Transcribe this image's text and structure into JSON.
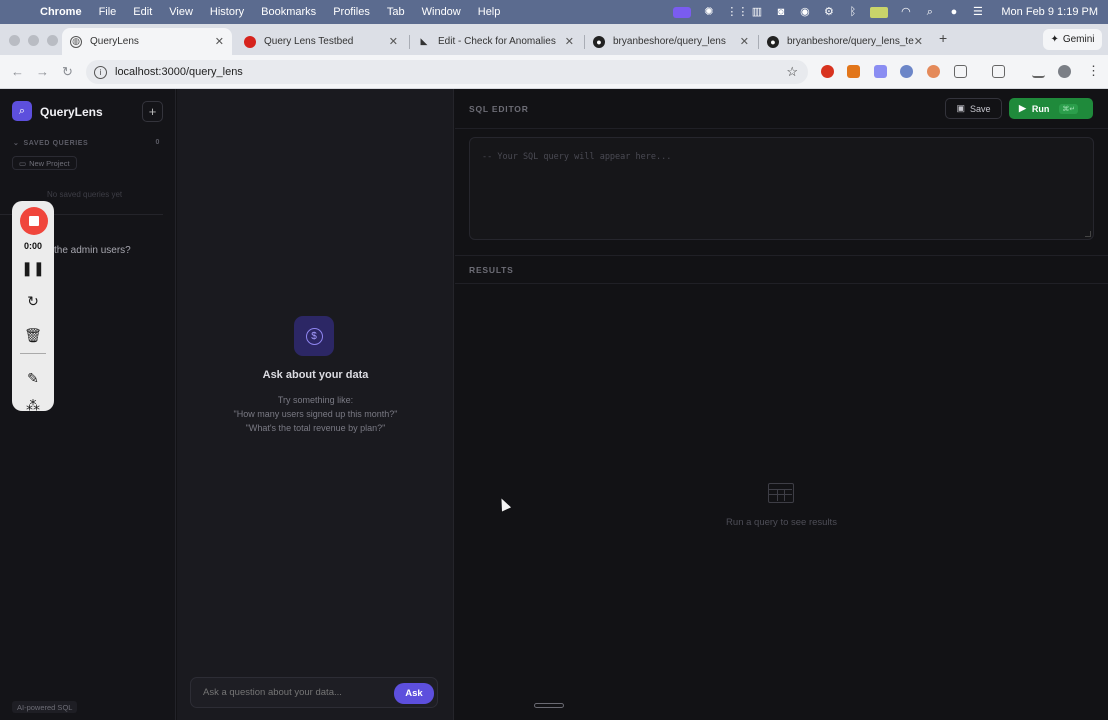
{
  "menubar": {
    "app": "Chrome",
    "items": [
      "File",
      "Edit",
      "View",
      "History",
      "Bookmarks",
      "Profiles",
      "Tab",
      "Window",
      "Help"
    ],
    "clock": "Mon Feb 9  1:19 PM"
  },
  "tabs": [
    {
      "label": "QueryLens",
      "icon": "globe-icon"
    },
    {
      "label": "Query Lens Testbed",
      "icon": "red-dot-icon"
    },
    {
      "label": "Edit - Check for Anomalies",
      "icon": "chart-icon"
    },
    {
      "label": "bryanbeshore/query_lens",
      "icon": "github-icon"
    },
    {
      "label": "bryanbeshore/query_lens_te",
      "icon": "github-icon"
    }
  ],
  "gemini_label": "Gemini",
  "address": {
    "url": "localhost:3000/query_lens"
  },
  "sidebar": {
    "app_name": "QueryLens",
    "saved_header": "SAVED QUERIES",
    "saved_count": "0",
    "new_project": "New Project",
    "no_saved": "No saved queries yet",
    "history_item": "the admin users?",
    "footer": "AI-powered SQL"
  },
  "recorder": {
    "time": "0:00"
  },
  "chat": {
    "empty_title": "Ask about your data",
    "empty_lines": [
      "Try something like:",
      "\"How many users signed up this month?\"",
      "\"What's the total revenue by plan?\""
    ],
    "input_placeholder": "Ask a question about your data...",
    "ask_button": "Ask"
  },
  "editor": {
    "label": "SQL EDITOR",
    "save": "Save",
    "run": "Run",
    "run_shortcut": "⌘↵",
    "placeholder": "-- Your SQL query will appear here...",
    "results_label": "RESULTS",
    "results_empty": "Run a query to see results"
  },
  "colors": {
    "accent": "#5d4fdd",
    "run_green": "#1f8a3b",
    "record_red": "#f0463c"
  }
}
